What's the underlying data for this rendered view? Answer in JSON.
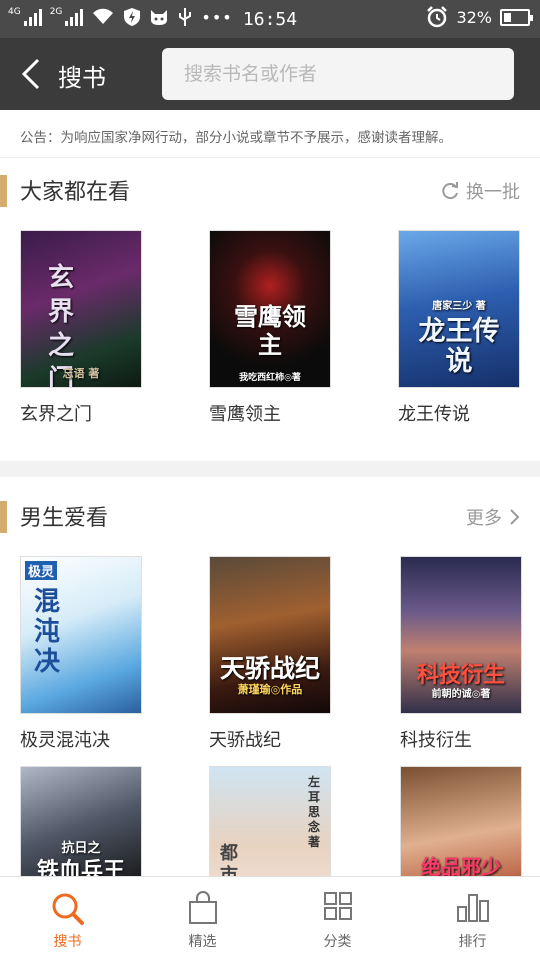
{
  "status_bar": {
    "sim1": "4G",
    "sim2": "2G",
    "time": "16:54",
    "battery": "32%",
    "battery_level": 0.32,
    "icons": [
      "signal-icon",
      "wifi-icon",
      "shield-icon",
      "cat-icon",
      "usb-icon",
      "more-dots-icon",
      "alarm-icon",
      "battery-icon"
    ]
  },
  "header": {
    "title": "搜书",
    "search_placeholder": "搜索书名或作者"
  },
  "notice": "公告：为响应国家净网行动，部分小说或章节不予展示，感谢读者理解。",
  "sections": {
    "popular": {
      "title": "大家都在看",
      "action": "换一批",
      "books": [
        {
          "title": "玄界之门",
          "cover_text": "玄界之门",
          "cover_byline": "忘语 著"
        },
        {
          "title": "雪鹰领主",
          "cover_text": "雪鹰领主",
          "cover_byline": "我吃西红柿◎著"
        },
        {
          "title": "龙王传说",
          "cover_text": "龙王传说",
          "cover_byline": "唐家三少 著"
        }
      ]
    },
    "male": {
      "title": "男生爱看",
      "action": "更多",
      "books": [
        {
          "title": "极灵混沌决",
          "cover_text": "混沌决",
          "cover_byline": "极灵"
        },
        {
          "title": "天骄战纪",
          "cover_text": "天骄战纪",
          "cover_byline": "萧瑾瑜◎作品"
        },
        {
          "title": "科技衍生",
          "cover_text": "科技衍生",
          "cover_byline": "前朝的诚◎著"
        },
        {
          "title": "",
          "cover_text": "铁血兵王",
          "cover_byline": "抗日之"
        },
        {
          "title": "",
          "cover_text": "都市之",
          "cover_byline": "左耳思念 著"
        },
        {
          "title": "",
          "cover_text": "绝品邪少",
          "cover_byline": ""
        }
      ]
    }
  },
  "tabs": [
    {
      "label": "搜书",
      "icon": "search-icon",
      "active": true
    },
    {
      "label": "精选",
      "icon": "bag-icon",
      "active": false
    },
    {
      "label": "分类",
      "icon": "grid-icon",
      "active": false
    },
    {
      "label": "排行",
      "icon": "ranking-icon",
      "active": false
    }
  ],
  "colors": {
    "accent": "#ef6a1f",
    "section_bar": "#d4ad6e",
    "topbar": "#3b3b3b"
  }
}
